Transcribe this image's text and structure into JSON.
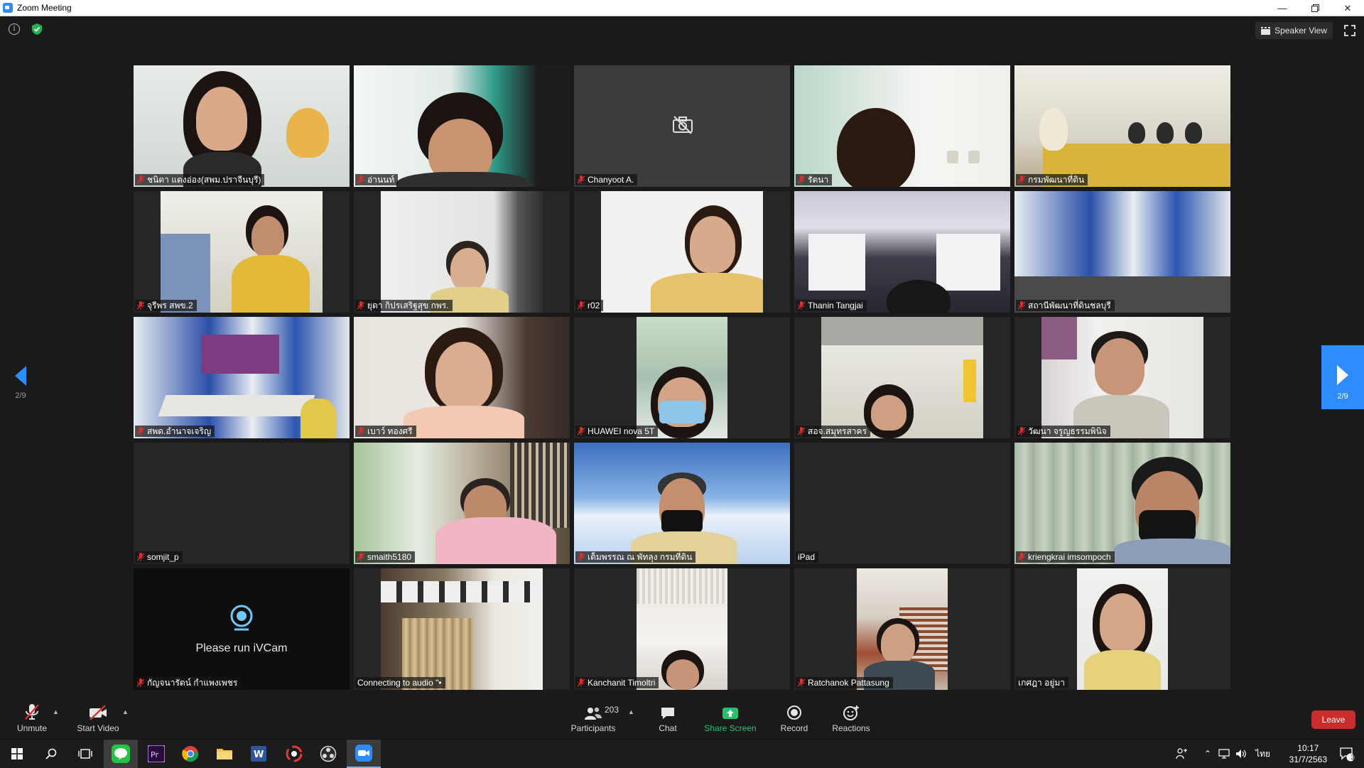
{
  "window": {
    "title": "Zoom Meeting"
  },
  "topbar": {
    "view_label": "Speaker View"
  },
  "participants": [
    {
      "name": "ชนิดา แตงอ่อง(สพม.ปราจีนบุรี)"
    },
    {
      "name": "อ่านนท์"
    },
    {
      "name": "Chanyoot A."
    },
    {
      "name": "รัตนา"
    },
    {
      "name": "กรมพัฒนาที่ดิน"
    },
    {
      "name": "จุรีพร สพข.2"
    },
    {
      "name": "ยุดา กิปรเสริฐสุข กพร."
    },
    {
      "name": "r02"
    },
    {
      "name": "Thanin Tangjai"
    },
    {
      "name": "สถานีพัฒนาที่ดินชลบุรี"
    },
    {
      "name": "สพด.อำนาจเจริญ"
    },
    {
      "name": "เบาว์ ทองศรี"
    },
    {
      "name": "HUAWEI nova 5T"
    },
    {
      "name": "สอจ.สมุทรสาคร"
    },
    {
      "name": "วัฒนา จรูญธรรมพินิจ"
    },
    {
      "name": "somjit_p"
    },
    {
      "name": "smaith5180"
    },
    {
      "name": "เต็มพรรณ ณ พัทลุง กรมที่ดิน"
    },
    {
      "name": "iPad"
    },
    {
      "name": "kriengkrai imsompoch"
    },
    {
      "name": "กัญจนารัตน์ กำแพงเพชร",
      "placeholder_text": "Please run iVCam"
    },
    {
      "name": "Connecting to audio \"•"
    },
    {
      "name": "Kanchanit Timoltri"
    },
    {
      "name": "Ratchanok Pattasung"
    },
    {
      "name": "เกศฎา อยู่มา"
    }
  ],
  "pagination": {
    "left": "2/9",
    "right": "2/9"
  },
  "toolbar": {
    "unmute": "Unmute",
    "start_video": "Start Video",
    "participants_count": "203",
    "participants": "Participants",
    "chat": "Chat",
    "share_screen": "Share Screen",
    "record": "Record",
    "reactions": "Reactions",
    "leave": "Leave"
  },
  "taskbar": {
    "language": "ไทย",
    "time": "10:17",
    "date": "31/7/2563",
    "notifications": "3"
  },
  "colors": {
    "accent": "#2d8cff",
    "leave": "#c82c2c",
    "share": "#25c16f"
  }
}
